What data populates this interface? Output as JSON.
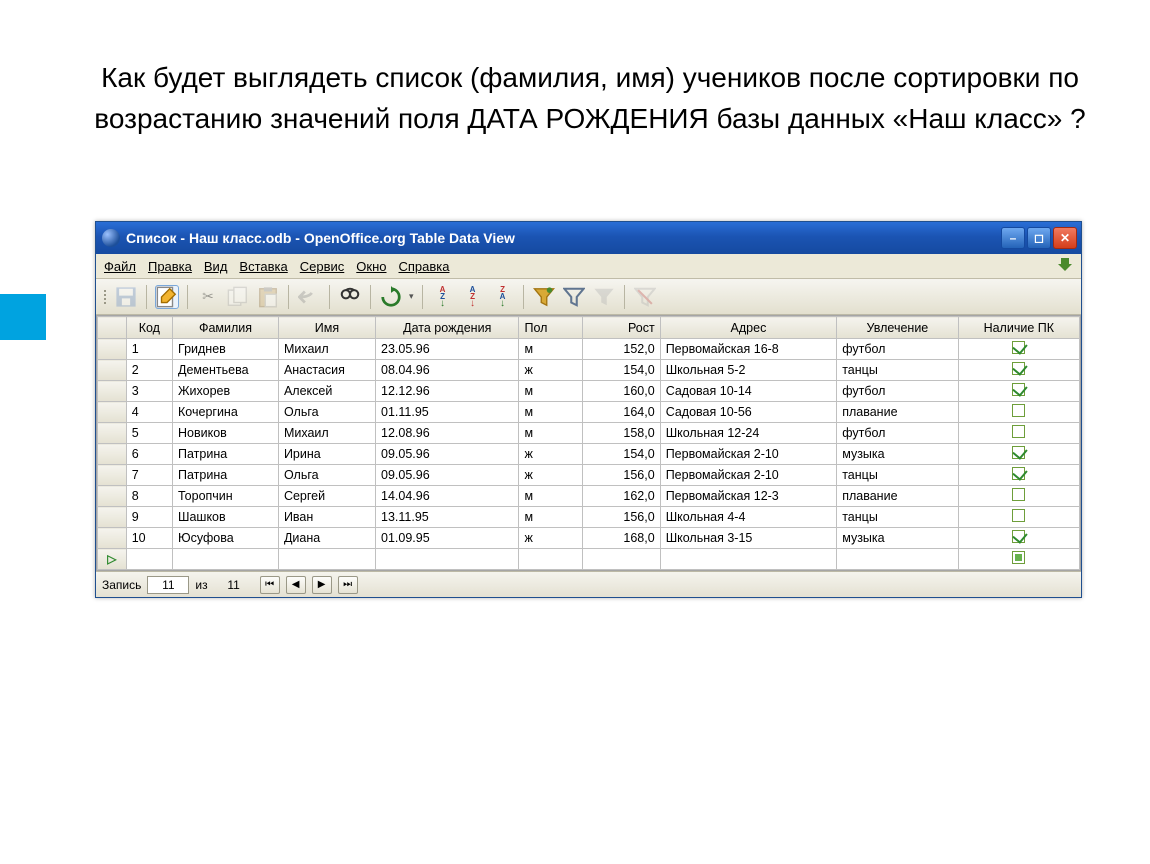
{
  "question": "Как будет выглядеть список (фамилия, имя) учеников после сортировки по возрастанию значений поля ДАТА РОЖДЕНИЯ базы данных «Наш класс» ?",
  "window": {
    "title": "Список - Наш класс.odb - OpenOffice.org Table Data View"
  },
  "menu": [
    "Файл",
    "Правка",
    "Вид",
    "Вставка",
    "Сервис",
    "Окно",
    "Справка"
  ],
  "columns": [
    "Код",
    "Фамилия",
    "Имя",
    "Дата рождения",
    "Пол",
    "Рост",
    "Адрес",
    "Увлечение",
    "Наличие ПК"
  ],
  "rows": [
    {
      "code": "1",
      "lname": "Гриднев",
      "fname": "Михаил",
      "bdate": "23.05.96",
      "sex": "м",
      "height": "152,0",
      "addr": "Первомайская 16-8",
      "hobby": "футбол",
      "pc": true
    },
    {
      "code": "2",
      "lname": "Дементьева",
      "fname": "Анастасия",
      "bdate": "08.04.96",
      "sex": "ж",
      "height": "154,0",
      "addr": "Школьная 5-2",
      "hobby": "танцы",
      "pc": true
    },
    {
      "code": "3",
      "lname": "Жихорев",
      "fname": "Алексей",
      "bdate": "12.12.96",
      "sex": "м",
      "height": "160,0",
      "addr": "Садовая 10-14",
      "hobby": "футбол",
      "pc": true
    },
    {
      "code": "4",
      "lname": "Кочергина",
      "fname": "Ольга",
      "bdate": "01.11.95",
      "sex": "м",
      "height": "164,0",
      "addr": "Садовая 10-56",
      "hobby": "плавание",
      "pc": false
    },
    {
      "code": "5",
      "lname": "Новиков",
      "fname": "Михаил",
      "bdate": "12.08.96",
      "sex": "м",
      "height": "158,0",
      "addr": "Школьная 12-24",
      "hobby": "футбол",
      "pc": false
    },
    {
      "code": "6",
      "lname": "Патрина",
      "fname": "Ирина",
      "bdate": "09.05.96",
      "sex": "ж",
      "height": "154,0",
      "addr": "Первомайская 2-10",
      "hobby": "музыка",
      "pc": true
    },
    {
      "code": "7",
      "lname": "Патрина",
      "fname": "Ольга",
      "bdate": "09.05.96",
      "sex": "ж",
      "height": "156,0",
      "addr": "Первомайская 2-10",
      "hobby": "танцы",
      "pc": true
    },
    {
      "code": "8",
      "lname": "Торопчин",
      "fname": "Сергей",
      "bdate": "14.04.96",
      "sex": "м",
      "height": "162,0",
      "addr": "Первомайская 12-3",
      "hobby": "плавание",
      "pc": false
    },
    {
      "code": "9",
      "lname": "Шашков",
      "fname": "Иван",
      "bdate": "13.11.95",
      "sex": "м",
      "height": "156,0",
      "addr": "Школьная 4-4",
      "hobby": "танцы",
      "pc": false
    },
    {
      "code": "10",
      "lname": "Юсуфова",
      "fname": "Диана",
      "bdate": "01.09.95",
      "sex": "ж",
      "height": "168,0",
      "addr": "Школьная 3-15",
      "hobby": "музыка",
      "pc": true
    }
  ],
  "status": {
    "label": "Запись",
    "current": "11",
    "of": "из",
    "total": "11"
  }
}
